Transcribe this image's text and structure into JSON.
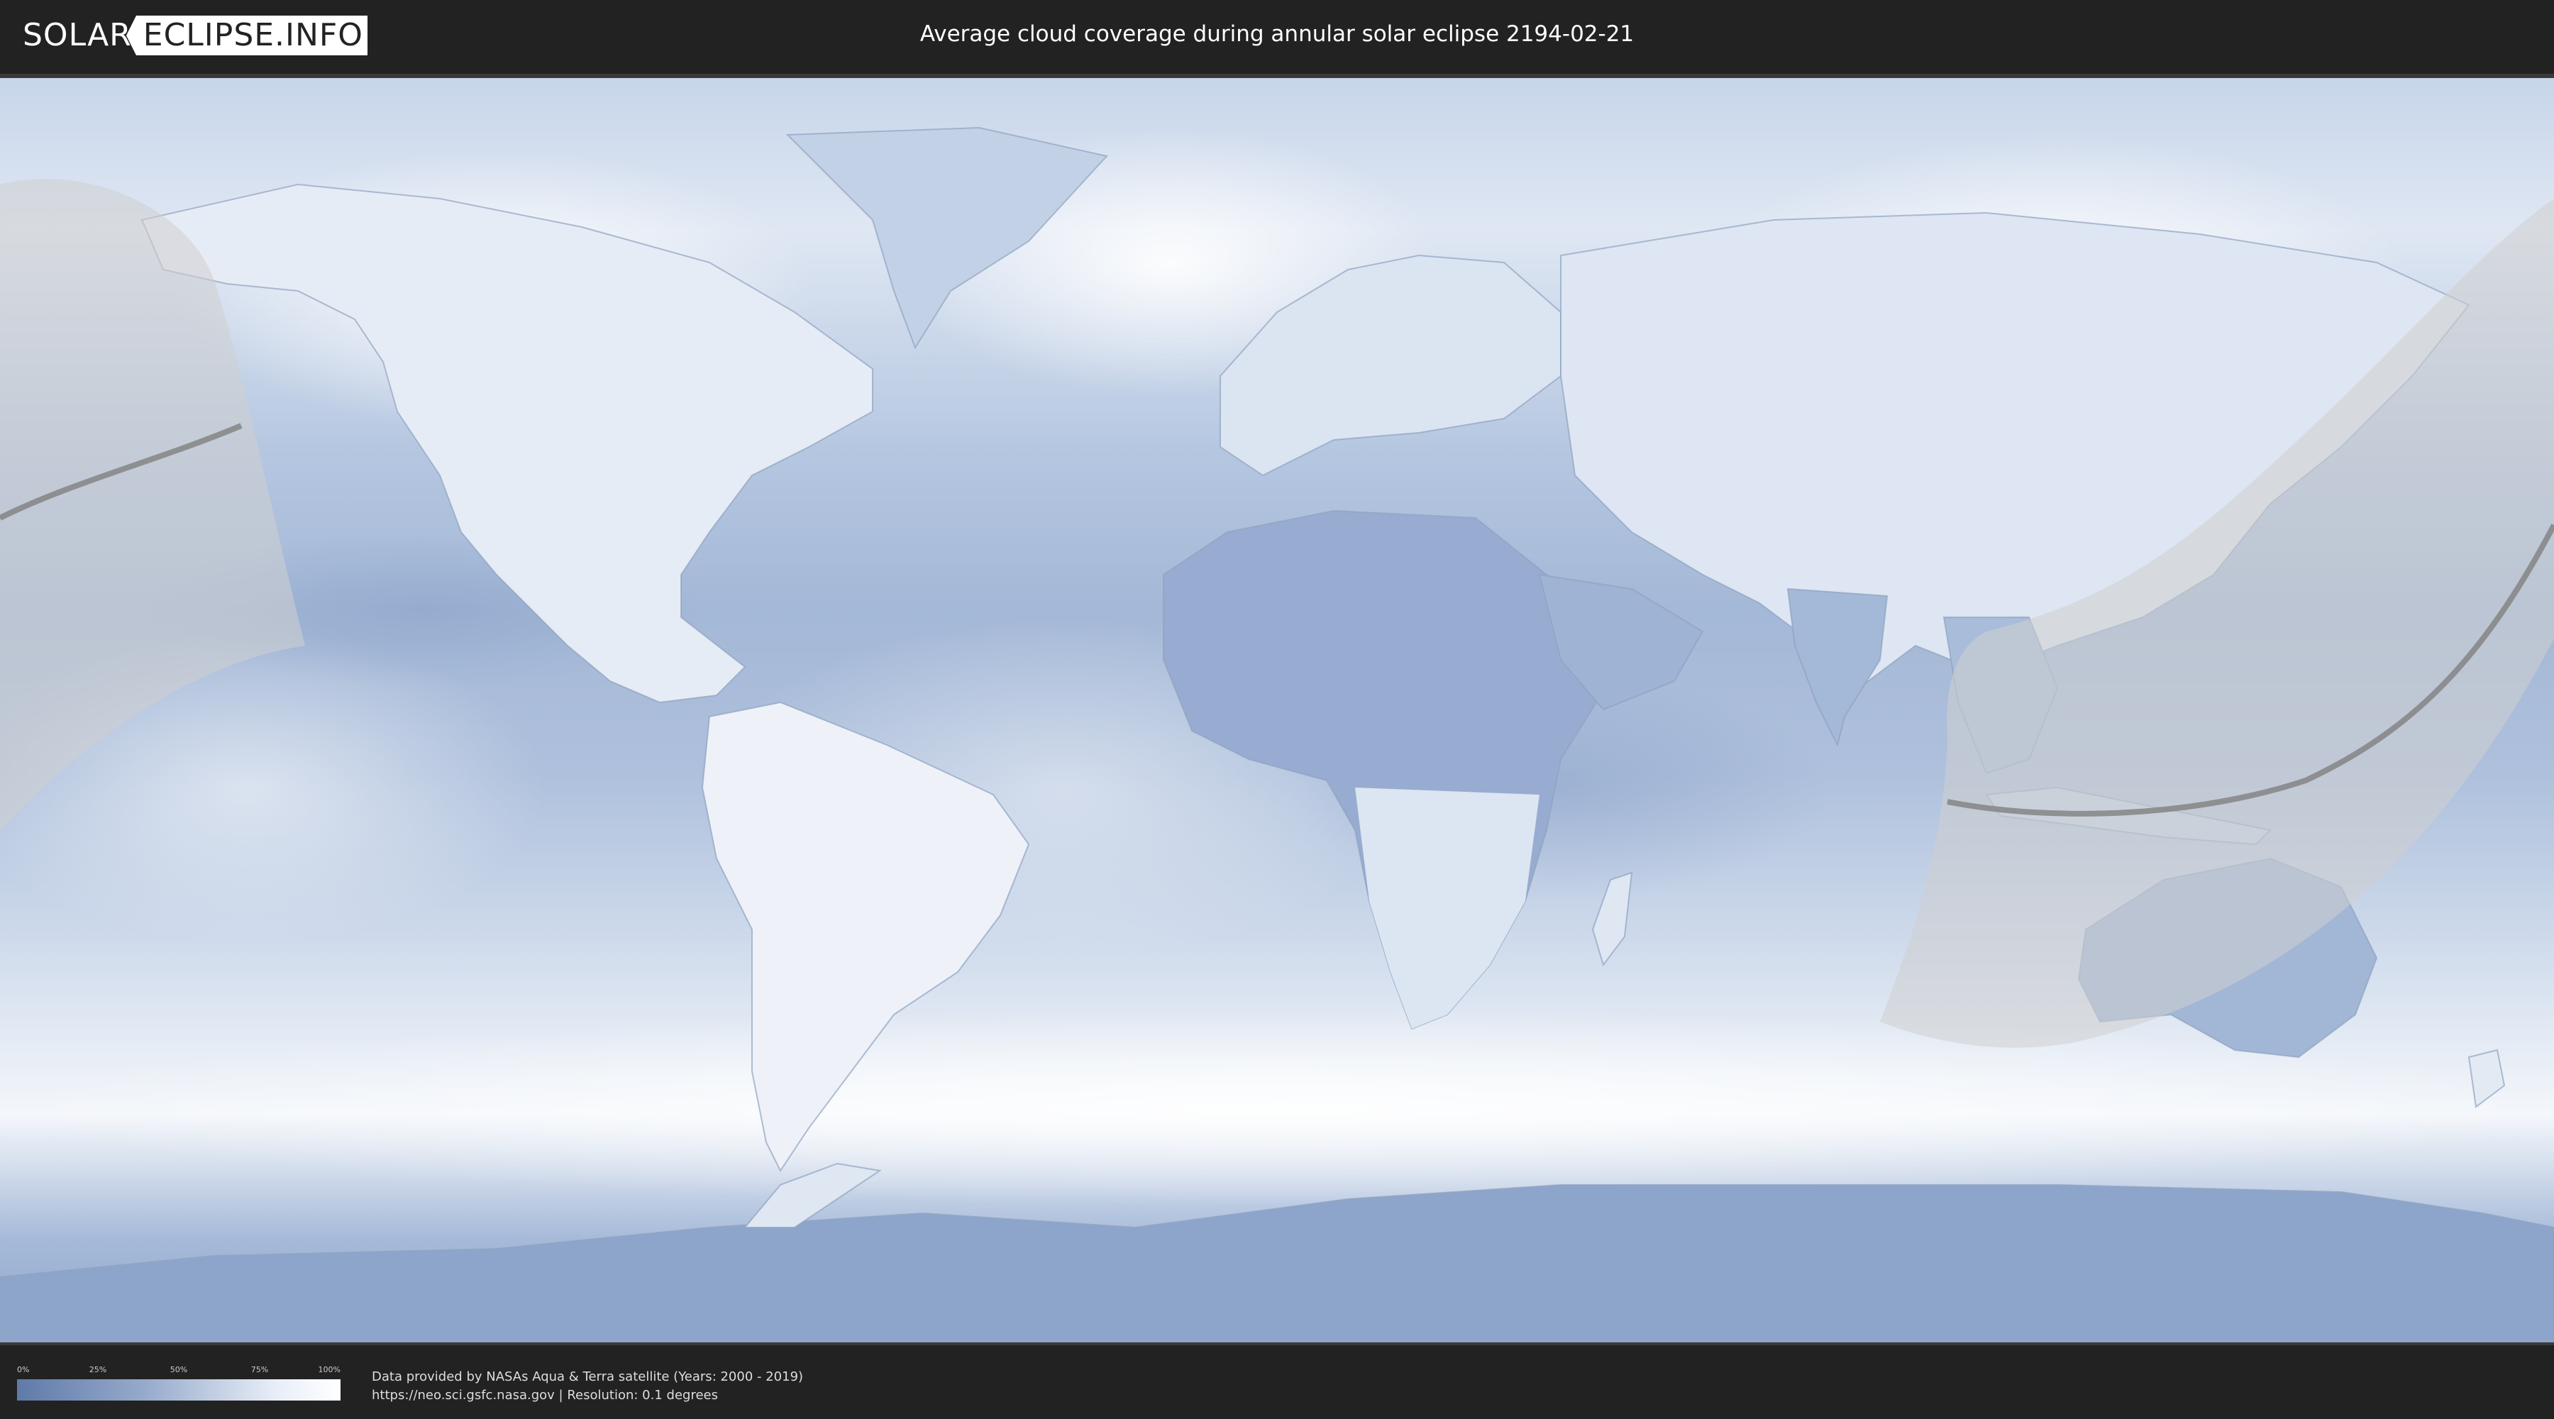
{
  "logo": {
    "left_text": "SOLAR",
    "right_text": "ECLIPSE.INFO"
  },
  "header": {
    "title": "Average cloud coverage during annular solar eclipse 2194-02-21"
  },
  "legend": {
    "ticks": [
      "0%",
      "25%",
      "50%",
      "75%",
      "100%"
    ]
  },
  "credits": {
    "line1": "Data provided by NASAs Aqua & Terra satellite (Years: 2000 - 2019)",
    "line2": "https://neo.sci.gsfc.nasa.gov | Resolution: 0.1 degrees"
  },
  "colors": {
    "background": "#222222",
    "ocean_cloud": "#a9bcd9",
    "land_clear": "#eef2f8",
    "dense_cloud": "#ffffff",
    "clear_sky": "#5f7aa9",
    "eclipse_zone": "#d9d9d9",
    "eclipse_path": "#7f7f7f"
  },
  "icons": {
    "logo_mark": "eclipse-logo-icon"
  }
}
